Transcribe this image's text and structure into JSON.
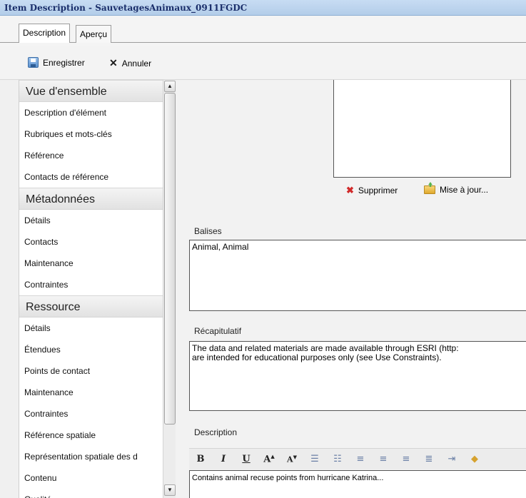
{
  "window": {
    "title": "Item Description - SauvetagesAnimaux_0911FGDC"
  },
  "tabs": [
    {
      "label": "Description",
      "active": true
    },
    {
      "label": "Aperçu",
      "active": false
    }
  ],
  "toolbar": {
    "save_label": "Enregistrer",
    "cancel_label": "Annuler"
  },
  "sidebar": {
    "sections": [
      {
        "title": "Vue d'ensemble",
        "items": [
          "Description d'élément",
          "Rubriques et mots-clés",
          "Référence",
          "Contacts de référence"
        ]
      },
      {
        "title": "Métadonnées",
        "items": [
          "Détails",
          "Contacts",
          "Maintenance",
          "Contraintes"
        ]
      },
      {
        "title": "Ressource",
        "items": [
          "Détails",
          "Étendues",
          "Points de contact",
          "Maintenance",
          "Contraintes",
          "Référence spatiale",
          "Représentation spatiale des d",
          "Contenu",
          "Qualité"
        ]
      }
    ]
  },
  "thumbnail": {
    "delete_label": "Supprimer",
    "update_label": "Mise à jour..."
  },
  "tags": {
    "label": "Balises",
    "value": "Animal, Animal"
  },
  "summary": {
    "label": "Récapitulatif",
    "line1": "The data and related materials are made available through ESRI (http:",
    "line2": "are intended for educational purposes only (see Use Constraints)."
  },
  "description": {
    "label": "Description",
    "value": "Contains animal recuse points from hurricane Katrina...",
    "toolbar": {
      "bold": "B",
      "italic": "I",
      "underline": "U",
      "grow_font": "A",
      "shrink_font": "A"
    }
  },
  "colors": {
    "titlebar": "#b3cde9",
    "title_text": "#1b2f6b",
    "delete_red": "#d12a2a"
  }
}
